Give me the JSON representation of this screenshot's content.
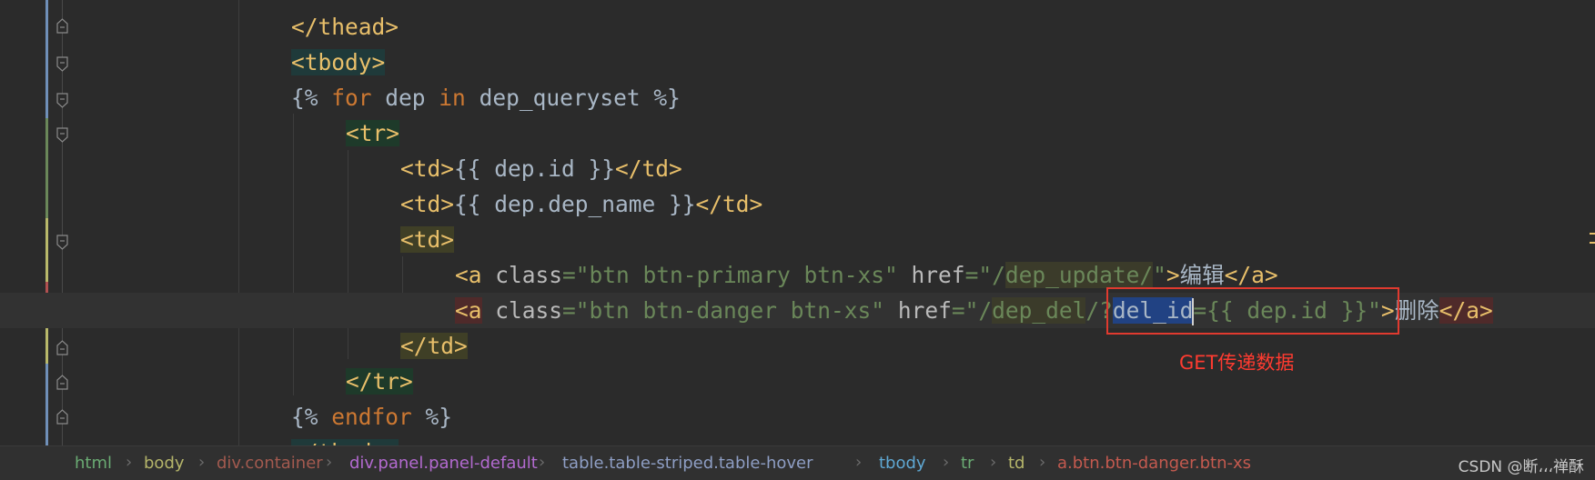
{
  "editor": {
    "lines": [
      {
        "id": "l1",
        "tokens": [
          [
            "</thead>",
            "tag"
          ]
        ]
      },
      {
        "id": "l2",
        "tokens": [
          [
            "<tbody>",
            "tag hl-teal"
          ]
        ]
      },
      {
        "id": "l3",
        "tokens": [
          [
            "{% ",
            "tmpl"
          ],
          [
            "for",
            "kw"
          ],
          [
            " dep ",
            "tmpl"
          ],
          [
            "in",
            "kw"
          ],
          [
            " dep_queryset %}",
            "tmpl"
          ]
        ]
      },
      {
        "id": "l4",
        "tokens": [
          [
            "<tr>",
            "tag hl-green"
          ]
        ]
      },
      {
        "id": "l5",
        "tokens": [
          [
            "<td>",
            "tag"
          ],
          [
            "{{ dep.id }}",
            "tmpl"
          ],
          [
            "</td>",
            "tag"
          ]
        ]
      },
      {
        "id": "l6",
        "tokens": [
          [
            "<td>",
            "tag"
          ],
          [
            "{{ dep.dep_name }}",
            "tmpl"
          ],
          [
            "</td>",
            "tag"
          ]
        ]
      },
      {
        "id": "l7",
        "tokens": [
          [
            "<td>",
            "tag hl-olive"
          ]
        ]
      },
      {
        "id": "l8",
        "tokens": [
          [
            "<a ",
            "tag"
          ],
          [
            "class",
            "attr"
          ],
          [
            "=\"btn btn-primary btn-xs\" ",
            "str"
          ],
          [
            "href",
            "attr"
          ],
          [
            "=\"/",
            "str"
          ],
          [
            "dep_update",
            "str hl-url"
          ],
          [
            "/",
            "str hl-url"
          ],
          [
            "\"",
            "str"
          ],
          [
            ">",
            "tag"
          ],
          [
            "编辑",
            "txt"
          ],
          [
            "</a>",
            "tag"
          ]
        ]
      },
      {
        "id": "l9",
        "tokens": [
          [
            "<a",
            "tag hl-red"
          ],
          [
            " ",
            "tag"
          ],
          [
            "class",
            "attr"
          ],
          [
            "=\"btn btn-danger btn-xs\" ",
            "str"
          ],
          [
            "href",
            "attr"
          ],
          [
            "=\"/",
            "str"
          ],
          [
            "dep_del",
            "str hl-url"
          ],
          [
            "/",
            "str"
          ],
          [
            "?",
            "str"
          ],
          [
            "del_id",
            "hl-sel"
          ],
          [
            "|",
            "caret"
          ],
          [
            "={{ dep.id }}\"",
            "str"
          ],
          [
            ">",
            "tag"
          ],
          [
            "删除",
            "txt"
          ],
          [
            "</a>",
            "tag hl-red"
          ]
        ]
      },
      {
        "id": "l10",
        "tokens": [
          [
            "</td>",
            "tag hl-olive"
          ]
        ]
      },
      {
        "id": "l11",
        "tokens": [
          [
            "</tr>",
            "tag hl-green"
          ]
        ]
      },
      {
        "id": "l12",
        "tokens": [
          [
            "{% ",
            "tmpl"
          ],
          [
            "endfor",
            "kw"
          ],
          [
            " %}",
            "tmpl"
          ]
        ]
      },
      {
        "id": "l13",
        "tokens": [
          [
            "</tbody>",
            "tag hl-teal"
          ]
        ]
      }
    ]
  },
  "annotation": {
    "label": "GET传递数据",
    "color": "#ff3b30"
  },
  "breadcrumb": {
    "items": [
      {
        "label": "html",
        "color": "#6aab73"
      },
      {
        "label": "body",
        "color": "#b5b56a"
      },
      {
        "label": "div.container",
        "color": "#a35a4f"
      },
      {
        "label": "div.panel.panel-default",
        "color": "#b36ad0"
      },
      {
        "label": "table.table-striped.table-hover",
        "color": "#8e9ec4"
      },
      {
        "label": "tbody",
        "color": "#5fa8d3"
      },
      {
        "label": "tr",
        "color": "#6aab73"
      },
      {
        "label": "td",
        "color": "#b5b56a"
      },
      {
        "label": "a.btn.btn-danger.btn-xs",
        "color": "#c45a4f"
      }
    ],
    "separator": "›"
  },
  "watermark": "CSDN @断،،،禅酥"
}
